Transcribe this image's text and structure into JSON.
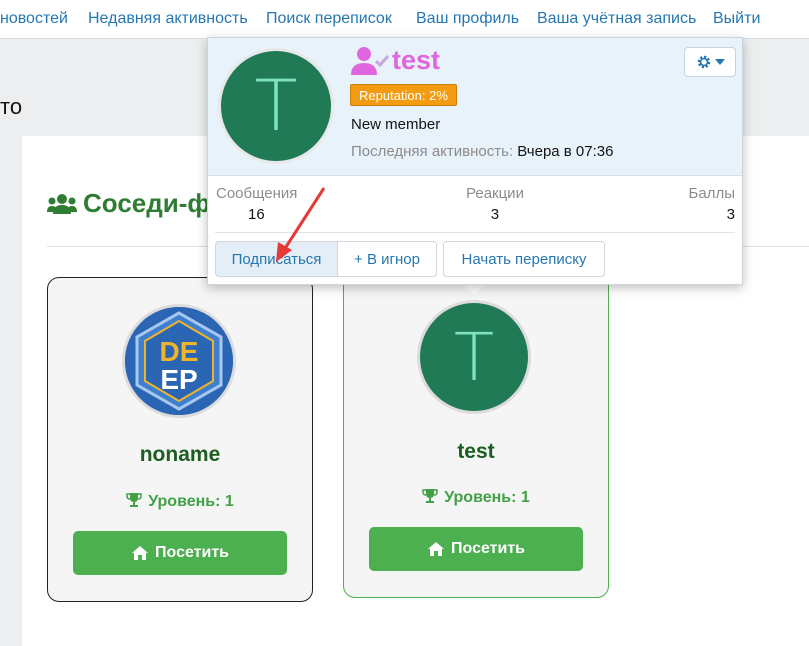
{
  "nav": {
    "items": [
      "новостей",
      "Недавняя активность",
      "Поиск переписок",
      "Ваш профиль",
      "Ваша учётная запись",
      "Выйти"
    ]
  },
  "page": {
    "partial_heading": "то",
    "section_title": "Соседи-ф"
  },
  "cards": [
    {
      "username": "noname",
      "avatar_text_top": "DE",
      "avatar_text_bottom": "EP",
      "level_label": "Уровень:",
      "level_value": "1",
      "visit_label": "Посетить"
    },
    {
      "username": "test",
      "avatar_letter": "T",
      "level_label": "Уровень:",
      "level_value": "1",
      "visit_label": "Посетить"
    }
  ],
  "popup": {
    "avatar_letter": "T",
    "username": "test",
    "reputation": "Reputation: 2%",
    "user_title": "New member",
    "last_activity_label": "Последняя активность:",
    "last_activity_value": "Вчера в 07:36",
    "stats": [
      {
        "label": "Сообщения",
        "value": "16"
      },
      {
        "label": "Реакции",
        "value": "3"
      },
      {
        "label": "Баллы",
        "value": "3"
      }
    ],
    "buttons": {
      "follow": "Подписаться",
      "ignore": "+ В игнор",
      "start_conversation": "Начать переписку"
    }
  },
  "colors": {
    "link": "#2577b1",
    "green": "#4caf50",
    "dark_green_title": "#2e7d32",
    "avatar_green": "#1f7a55",
    "username_pink": "#e066e0",
    "reputation_orange": "#f39c12",
    "annotation_red": "#e53935"
  },
  "icons": [
    "users-icon",
    "trophy-icon",
    "home-icon",
    "user-check-icon",
    "gear-icon",
    "caret-down-icon"
  ]
}
